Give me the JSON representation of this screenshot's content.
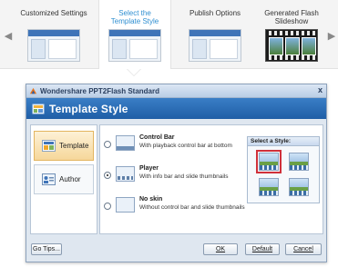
{
  "carousel": {
    "steps": [
      {
        "label": "Customized Settings"
      },
      {
        "label": "Select the Template Style"
      },
      {
        "label": "Publish Options"
      },
      {
        "label": "Generated Flash Slideshow"
      }
    ],
    "prev_icon": "chevron-left-icon",
    "next_icon": "chevron-right-icon"
  },
  "dialog": {
    "title": "Wondershare PPT2Flash Standard",
    "close_glyph": "x",
    "header_title": "Template Style",
    "sidebar": [
      {
        "label": "Template"
      },
      {
        "label": "Author"
      }
    ],
    "options": [
      {
        "name": "Control Bar",
        "desc": "With playback control bar at bottom",
        "selected": false
      },
      {
        "name": "Player",
        "desc": "With info bar and slide thumbnails",
        "selected": true
      },
      {
        "name": "No skin",
        "desc": "Without control bar and slide thumbnails",
        "selected": false
      }
    ],
    "style_panel": {
      "title": "Select a Style:"
    },
    "buttons": {
      "tips": "Go Tips...",
      "ok": "OK",
      "default": "Default",
      "cancel": "Cancel"
    }
  },
  "colors": {
    "accent": "#2f8fd1",
    "header_blue": "#1f5ea6",
    "selection_red": "#d0303a"
  }
}
